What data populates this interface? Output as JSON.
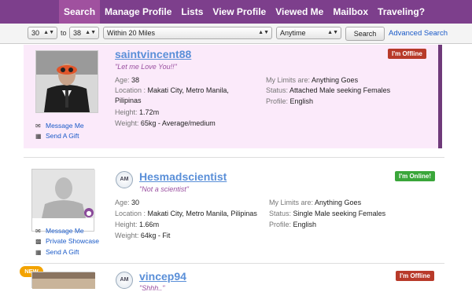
{
  "nav": {
    "tabs": [
      {
        "label": "Search",
        "active": true
      },
      {
        "label": "Manage Profile"
      },
      {
        "label": "Lists"
      },
      {
        "label": "View Profile"
      },
      {
        "label": "Viewed Me"
      },
      {
        "label": "Mailbox"
      },
      {
        "label": "Traveling?"
      }
    ]
  },
  "filters": {
    "age_min": "30",
    "to_label": "to",
    "age_max": "38",
    "distance": "Within 20 Miles",
    "time": "Anytime",
    "search_label": "Search",
    "advanced_label": "Advanced Search"
  },
  "profiles": [
    {
      "username": "saintvincent88",
      "tagline": "\"Let me Love You!!\"",
      "status_badge": "I'm Offline",
      "age_label": "Age:",
      "age": "38",
      "location_label": "Location :",
      "location": "Makati City, Metro Manila,",
      "location_line2": "Pilipinas",
      "height_label": "Height:",
      "height": "1.72m",
      "weight_label": "Weight:",
      "weight": "65kg - Average/medium",
      "limits_label": "My Limits are:",
      "limits": "Anything Goes",
      "status_label": "Status:",
      "status": "Attached Male seeking Females",
      "profile_label": "Profile:",
      "profile": "English",
      "actions": [
        "Message Me",
        "Send A Gift"
      ]
    },
    {
      "username": "Hesmadscientist",
      "tagline": "\"Not a scientist\"",
      "status_badge": "I'm Online!",
      "age_label": "Age:",
      "age": "30",
      "location_label": "Location :",
      "location": "Makati City, Metro Manila, Pilipinas",
      "height_label": "Height:",
      "height": "1.66m",
      "weight_label": "Weight:",
      "weight": "64kg - Fit",
      "limits_label": "My Limits are:",
      "limits": "Anything Goes",
      "status_label": "Status:",
      "status": "Single Male seeking Females",
      "profile_label": "Profile:",
      "profile": "English",
      "actions": [
        "Message Me",
        "Private Showcase",
        "Send A Gift"
      ],
      "am_icon": "AM"
    },
    {
      "username": "vincep94",
      "tagline": "\"Shhh..\"",
      "status_badge": "I'm Offline",
      "new_badge": "NEW",
      "am_icon": "AM"
    }
  ],
  "colors": {
    "nav_bg": "#7d3f8c",
    "nav_active": "#a0519f",
    "card_highlight": "#fbeafa",
    "link": "#1a5ac8",
    "offline": "#b83a2a",
    "online": "#3aa63a"
  }
}
